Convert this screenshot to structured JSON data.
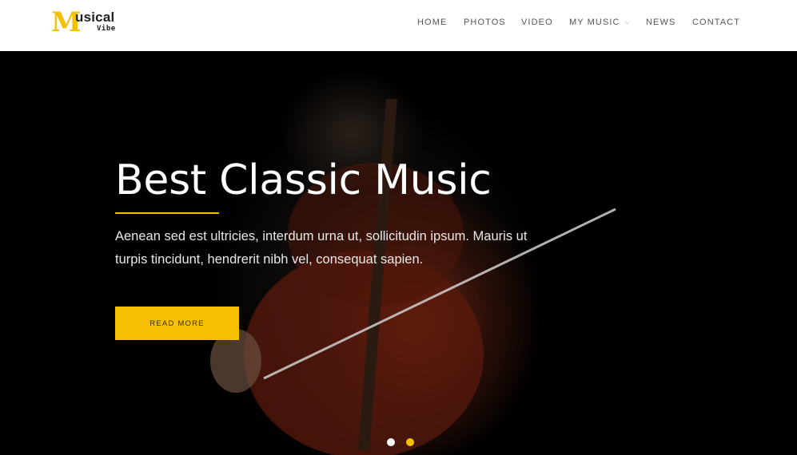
{
  "brand": {
    "logo_initial": "M",
    "logo_top": "usical",
    "logo_bottom": "Vibe"
  },
  "nav": {
    "items": [
      {
        "label": "HOME"
      },
      {
        "label": "PHOTOS"
      },
      {
        "label": "VIDEO"
      },
      {
        "label": "MY MUSIC",
        "has_dropdown": true
      },
      {
        "label": "NEWS"
      },
      {
        "label": "CONTACT"
      }
    ],
    "dropdown_icon": "chevron-down-icon"
  },
  "hero": {
    "title": "Best Classic Music",
    "description": "Aenean sed est ultricies, interdum urna ut, sollicitudin ipsum. Mauris ut turpis tincidunt, hendrerit nibh vel, consequat sapien.",
    "button_label": "READ MORE",
    "slides": {
      "count": 2,
      "active": 1
    }
  },
  "colors": {
    "accent": "#f5c000",
    "header_bg": "#ffffff",
    "hero_bg": "#000000",
    "active_dot": "#ffffff"
  }
}
